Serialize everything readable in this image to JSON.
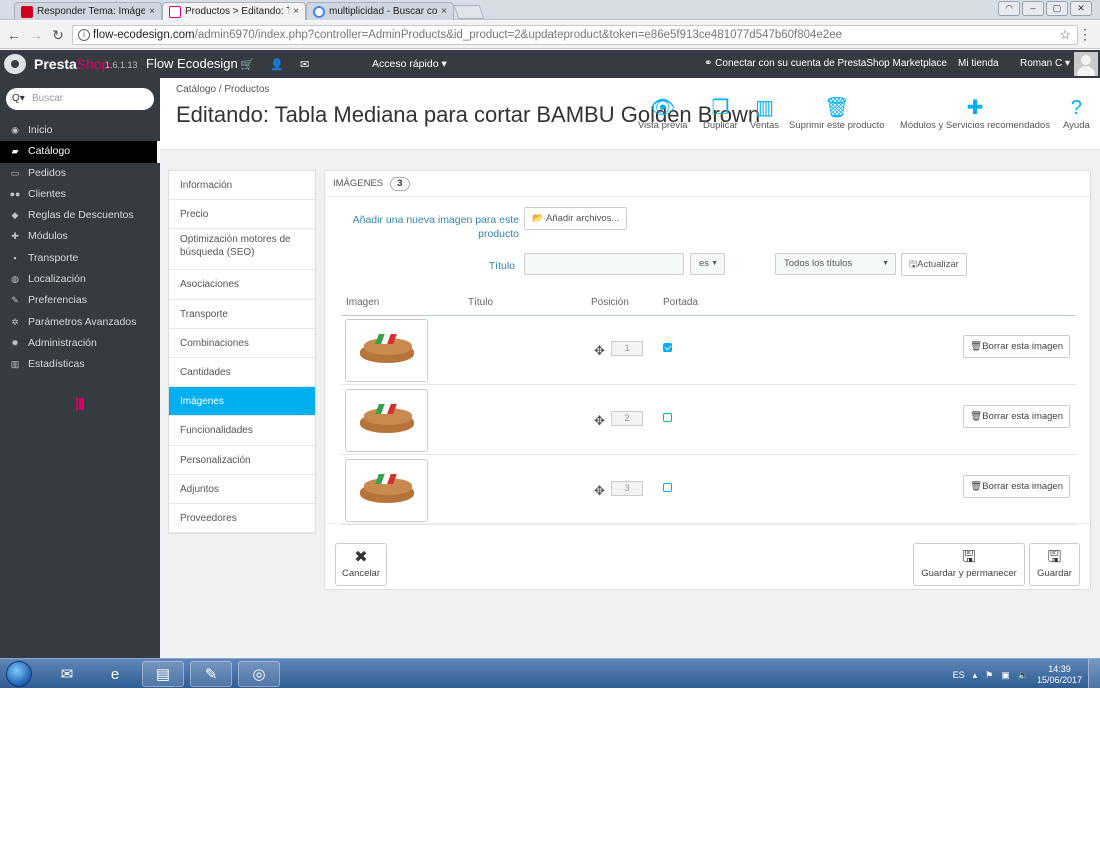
{
  "browser": {
    "tabs": [
      {
        "label": "Responder Tema: Imágen",
        "close": "×",
        "favicon_color": "#d0021b"
      },
      {
        "label": "Productos > Editando: Ta",
        "close": "×",
        "favicon_color": "#df0067"
      },
      {
        "label": "multiplicidad - Buscar co",
        "close": "×",
        "favicon_color": "#4285f4"
      }
    ],
    "url_host": "flow-ecodesign.com",
    "url_path": "/admin6970/index.php?controller=AdminProducts&id_product=2&updateproduct&token=e86e5f913ce481077d547b60f804e2ee"
  },
  "header": {
    "brand_presta": "Presta",
    "brand_shop": "Shop",
    "version": "1.6.1.13",
    "store_name": "Flow Ecodesign",
    "quick_access": "Acceso rápido ▾",
    "connect": "Conectar con su cuenta de PrestaShop Marketplace",
    "my_store": "Mi tienda",
    "user": "Roman C ▾"
  },
  "sidebar": {
    "search_placeholder": "Buscar",
    "items": [
      {
        "label": "Inicio",
        "icon": "dashboard-icon"
      },
      {
        "label": "Catálogo",
        "icon": "book-icon"
      },
      {
        "label": "Pedidos",
        "icon": "credit-card-icon"
      },
      {
        "label": "Clientes",
        "icon": "users-icon"
      },
      {
        "label": "Reglas de Descuentos",
        "icon": "tag-icon"
      },
      {
        "label": "Módulos",
        "icon": "puzzle-icon"
      },
      {
        "label": "Transporte",
        "icon": "truck-icon"
      },
      {
        "label": "Localización",
        "icon": "globe-icon"
      },
      {
        "label": "Preferencias",
        "icon": "wrench-icon"
      },
      {
        "label": "Parámetros Avanzados",
        "icon": "cogs-icon"
      },
      {
        "label": "Administración",
        "icon": "cog-icon"
      },
      {
        "label": "Estadísticas",
        "icon": "bar-chart-icon"
      }
    ],
    "active_item": "Catálogo"
  },
  "page": {
    "breadcrumb": "Catálogo  /  Productos",
    "title": "Editando: Tabla Mediana para cortar BAMBU Golden Brown",
    "toolbar": [
      {
        "label": "Vista previa",
        "icon": "eye-icon"
      },
      {
        "label": "Duplicar",
        "icon": "copy-icon"
      },
      {
        "label": "Ventas",
        "icon": "bar-chart-icon"
      },
      {
        "label": "Suprimir este producto",
        "icon": "trash-icon"
      },
      {
        "label": "Módulos y Servicios recomendados",
        "icon": "puzzle-icon"
      },
      {
        "label": "Ayuda",
        "icon": "help-icon"
      }
    ]
  },
  "product_tabs": [
    "Información",
    "Precio",
    "Optimización motores de búsqueda (SEO)",
    "Asociaciones",
    "Transporte",
    "Combinaciones",
    "Cantidades",
    "Imágenes",
    "Funcionalidades",
    "Personalización",
    "Adjuntos",
    "Proveedores"
  ],
  "active_tab": "Imágenes",
  "images_panel": {
    "heading": "Imágenes",
    "count": "3",
    "add_label": "Añadir una nueva imagen para este producto",
    "add_button": "Añadir archivos...",
    "title_label": "Título",
    "title_value": "",
    "lang": "es",
    "titles_select": "Todos los títulos",
    "update_button": "Actualizar",
    "columns": [
      "Imagen",
      "Título",
      "Posición",
      "Portada"
    ],
    "rows": [
      {
        "title": "",
        "position": "1",
        "cover": true,
        "delete": "Borrar esta imagen"
      },
      {
        "title": "",
        "position": "2",
        "cover": false,
        "delete": "Borrar esta imagen"
      },
      {
        "title": "",
        "position": "3",
        "cover": false,
        "delete": "Borrar esta imagen"
      }
    ],
    "cancel": "Cancelar",
    "save_stay": "Guardar y permanecer",
    "save": "Guardar"
  },
  "taskbar": {
    "lang": "ES",
    "time": "14:39",
    "date": "15/06/2017"
  }
}
